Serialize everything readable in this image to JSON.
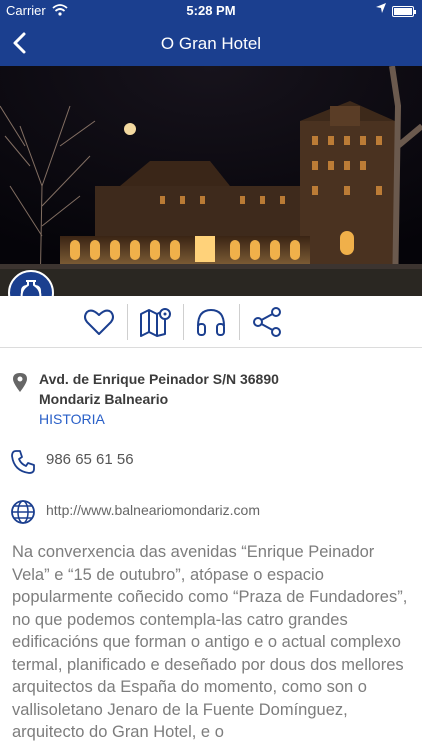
{
  "status_bar": {
    "carrier": "Carrier",
    "time": "5:28 PM"
  },
  "nav": {
    "title": "O Gran Hotel"
  },
  "carousel": {
    "count": 5,
    "active_index": 0
  },
  "actions": [
    "heart-icon",
    "map-icon",
    "headphones-icon",
    "share-icon"
  ],
  "address": {
    "line1": "Avd. de Enrique Peinador S/N  36890",
    "line2": "Mondariz Balneario",
    "category": "HISTORIA"
  },
  "phone": "986 65 61 56",
  "website": "http://www.balneariomondariz.com",
  "description": "Na converxencia das avenidas “Enrique Peinador Vela” e “15 de outubro”, atópase o espacio popularmente coñecido como “Praza de Fundadores”, no que podemos contempla-las catro grandes edificacións que forman o antigo e o actual complexo termal, planificado e deseñado por dous dos mellores arquitectos da España do momento, como son o vallisoletano Jenaro de la Fuente Domínguez, arquitecto do Gran Hotel, e o",
  "colors": {
    "brand": "#1b3f8f",
    "link": "#2a60c8",
    "body_text": "#7d7d7d"
  }
}
